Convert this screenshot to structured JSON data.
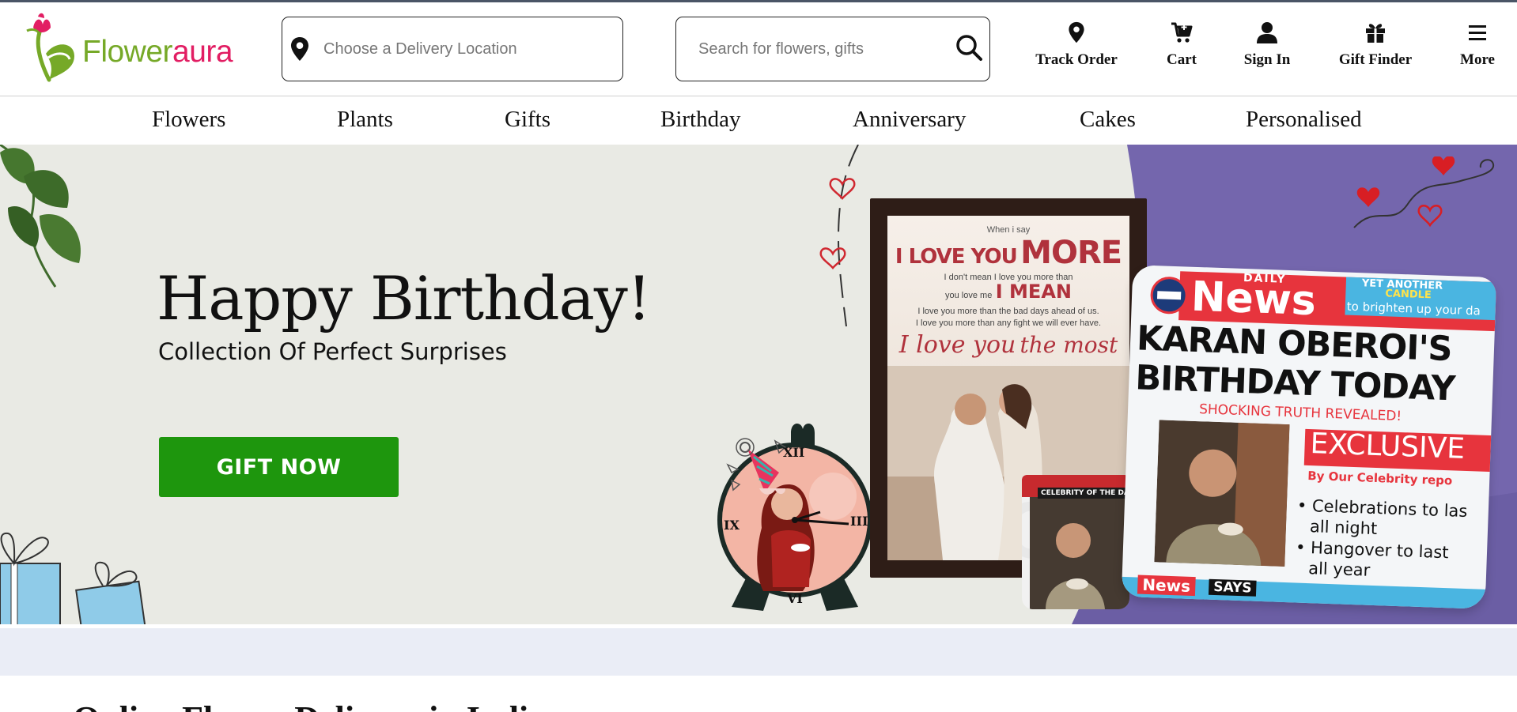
{
  "brand": {
    "name_part1": "Flower",
    "name_part2": "aura",
    "green": "#76a928",
    "pink": "#e21e63"
  },
  "location": {
    "placeholder": "Choose a Delivery Location",
    "icon": "map-pin-icon"
  },
  "search": {
    "placeholder": "Search for flowers, gifts",
    "icon": "search-icon"
  },
  "header_nav": [
    {
      "label": "Track Order",
      "icon": "map-pin-icon"
    },
    {
      "label": "Cart",
      "icon": "cart-icon"
    },
    {
      "label": "Sign In",
      "icon": "user-icon"
    },
    {
      "label": "Gift Finder",
      "icon": "gift-icon"
    },
    {
      "label": "More",
      "icon": "hamburger-icon"
    }
  ],
  "categories": [
    "Flowers",
    "Plants",
    "Gifts",
    "Birthday",
    "Anniversary",
    "Cakes",
    "Personalised"
  ],
  "banner": {
    "title": "Happy Birthday!",
    "subtitle": "Collection Of Perfect Surprises",
    "cta": "GIFT NOW",
    "cta_color": "#1e960d",
    "frame": {
      "line1": "When i say",
      "line2a": "I LOVE YOU",
      "line2b": "MORE",
      "line3": "I don't mean I love you more than",
      "line4a": "you love me",
      "line4b": "I MEAN",
      "line5": "I love you more than the bad days ahead of us.",
      "line6": "I love you more than any fight we will ever have.",
      "line7a": "I love you",
      "line7b": "the most"
    },
    "pillow": {
      "daily": "DAILY",
      "masthead": "News",
      "tagline1": "YET ANOTHER",
      "tagline2": "CANDLE",
      "tagline3": "to brighten up your da",
      "headline1": "KARAN OBEROI'S",
      "headline2": "BIRTHDAY TODAY",
      "shocking": "SHOCKING TRUTH REVEALED!",
      "exclusive": "EXCLUSIVE",
      "byline": "By Our Celebrity repo",
      "bullet1a": "• Celebrations to las",
      "bullet1b": "all night",
      "bullet2a": "• Hangover to last",
      "bullet2b": "all year",
      "footer1": "News",
      "footer2": "SAYS"
    },
    "mug": {
      "banner": "CELEBRITY OF THE DAY"
    },
    "clock": {
      "xii": "XII",
      "iii": "III",
      "vi": "VI",
      "ix": "IX"
    }
  },
  "section_heading": "Online Flower Delivery in India"
}
